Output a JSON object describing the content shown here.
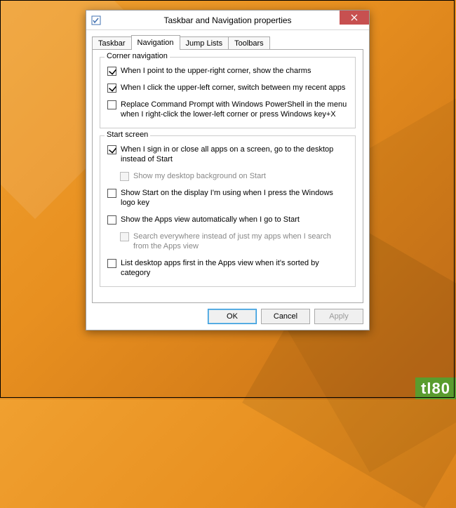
{
  "window": {
    "title": "Taskbar and Navigation properties"
  },
  "tabs": [
    {
      "label": "Taskbar",
      "active": false
    },
    {
      "label": "Navigation",
      "active": true
    },
    {
      "label": "Jump Lists",
      "active": false
    },
    {
      "label": "Toolbars",
      "active": false
    }
  ],
  "groups": {
    "corner": {
      "legend": "Corner navigation",
      "items": [
        {
          "label": "When I point to the upper-right corner, show the charms",
          "checked": true,
          "disabled": false,
          "indent": false
        },
        {
          "label": "When I click the upper-left corner, switch between my recent apps",
          "checked": true,
          "disabled": false,
          "indent": false
        },
        {
          "label": "Replace Command Prompt with Windows PowerShell in the menu when I right-click the lower-left corner or press Windows key+X",
          "checked": false,
          "disabled": false,
          "indent": false
        }
      ]
    },
    "start": {
      "legend": "Start screen",
      "items": [
        {
          "label": "When I sign in or close all apps on a screen, go to the desktop instead of Start",
          "checked": true,
          "disabled": false,
          "indent": false
        },
        {
          "label": "Show my desktop background on Start",
          "checked": false,
          "disabled": true,
          "indent": true
        },
        {
          "label": "Show Start on the display I'm using when I press the Windows logo key",
          "checked": false,
          "disabled": false,
          "indent": false
        },
        {
          "label": "Show the Apps view automatically when I go to Start",
          "checked": false,
          "disabled": false,
          "indent": false
        },
        {
          "label": "Search everywhere instead of just my apps when I search from the Apps view",
          "checked": false,
          "disabled": true,
          "indent": true
        },
        {
          "label": "List desktop apps first in the Apps view when it's sorted by category",
          "checked": false,
          "disabled": false,
          "indent": false
        }
      ]
    }
  },
  "buttons": {
    "ok": "OK",
    "cancel": "Cancel",
    "apply": "Apply"
  },
  "watermark": "tl80"
}
